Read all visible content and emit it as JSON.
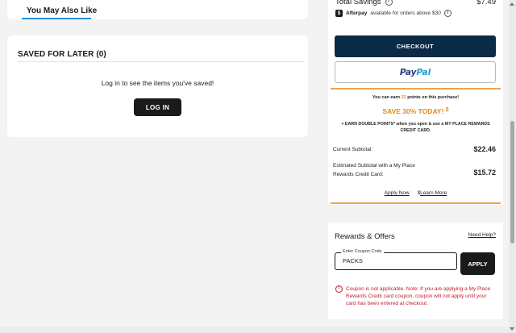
{
  "you_may_also_like": {
    "tab_label": "You May Also Like"
  },
  "saved_for_later": {
    "title": "SAVED FOR LATER (0)",
    "message": "Log in to see the items you've saved!",
    "login_label": "LOG IN"
  },
  "summary": {
    "total_savings_label": "Total Savings",
    "total_savings_value": "$7.49",
    "afterpay_logo": "$",
    "afterpay_name": "Afterpay",
    "afterpay_text": "available for orders above $30",
    "checkout_label": "CHECKOUT",
    "paypal_pay": "Pay",
    "paypal_pal": "Pal",
    "earn_prefix": "You can earn",
    "earn_points": "22",
    "earn_suffix": "points on this purchase!",
    "save_today": "SAVE 30% TODAY!",
    "double_points": "+ EARN DOUBLE POINTS* when you open & use a MY PLACE REWARDS CREDIT CARD.",
    "current_subtotal_label": "Current Subtotal:",
    "current_subtotal_value": "$22.46",
    "estimated_subtotal_label": "Estimated Subtotal with a My Place Rewards Credit Card:",
    "estimated_subtotal_value": "$15.72",
    "apply_now": "Apply Now",
    "learn_more": "Learn More"
  },
  "rewards": {
    "title": "Rewards & Offers",
    "need_help": "Need Help?",
    "coupon_label": "Enter Coupon Code",
    "coupon_value": "PACKS",
    "apply_label": "APPLY",
    "error_message": "Coupon is not applicable. Note: If you are applying a My Place Rewards Credit card coupon, coupon will not apply until your card has been entered at checkout."
  },
  "colors": {
    "accent_orange": "#f0a24b",
    "checkout_navy": "#0b2a45",
    "error_red": "#c21f2c",
    "tab_blue": "#2a8fd6"
  }
}
